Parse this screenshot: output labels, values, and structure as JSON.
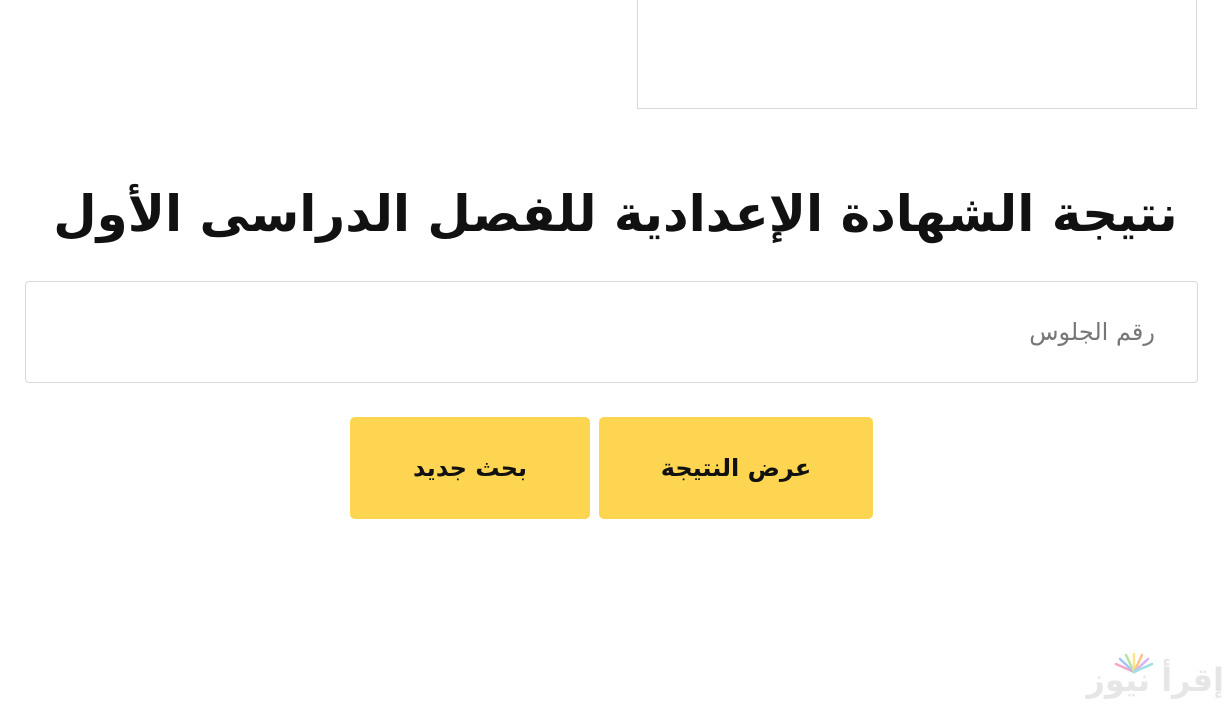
{
  "page": {
    "title": "نتيجة الشهادة الإعدادية للفصل الدراسى الأول"
  },
  "form": {
    "seat_number_placeholder": "رقم الجلوس",
    "seat_number_value": "",
    "show_result_label": "عرض النتيجة",
    "new_search_label": "بحث جديد"
  },
  "watermark": {
    "text": "إقرأ نيوز"
  },
  "colors": {
    "button_bg": "#fdd550",
    "border": "#d9d9d9",
    "title_text": "#111111"
  }
}
